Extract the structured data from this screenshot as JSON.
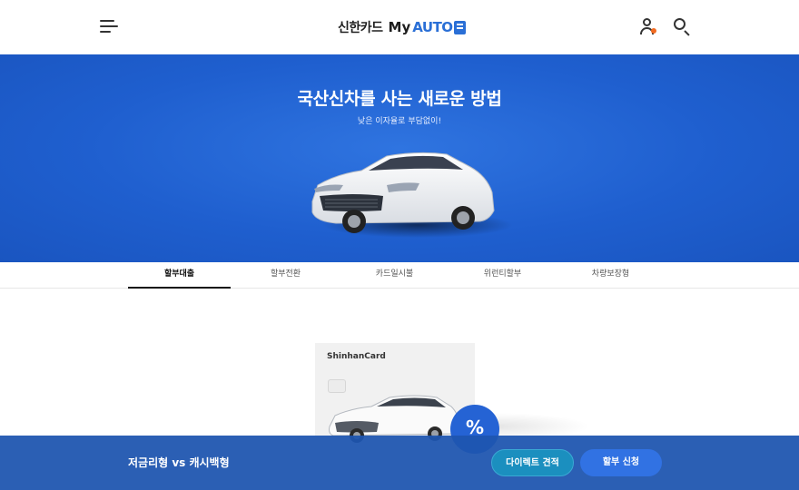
{
  "header": {
    "logo": {
      "korean": "신한카드",
      "my": "My",
      "auto": "AUTO"
    },
    "icons": {
      "menu": "menu-icon",
      "user": "user-icon",
      "search": "search-icon"
    },
    "notification_color": "#f26b21"
  },
  "hero": {
    "title": "국산신차를 사는 새로운 방법",
    "subtitle": "낮은 이자율로 부담없이!",
    "background_color": "#1f5fcf"
  },
  "tabs": [
    {
      "label": "할부대출",
      "active": true
    },
    {
      "label": "할부전환",
      "active": false
    },
    {
      "label": "카드일시불",
      "active": false
    },
    {
      "label": "위런티할부",
      "active": false
    },
    {
      "label": "차량보장형",
      "active": false
    }
  ],
  "card": {
    "brand": "ShinhanCard",
    "badge": "%"
  },
  "bottom_bar": {
    "title": "저금리형 vs 캐시백형",
    "direct_button": "다이렉트 견적",
    "apply_button": "할부 신청",
    "background_color": "#1e55af"
  }
}
